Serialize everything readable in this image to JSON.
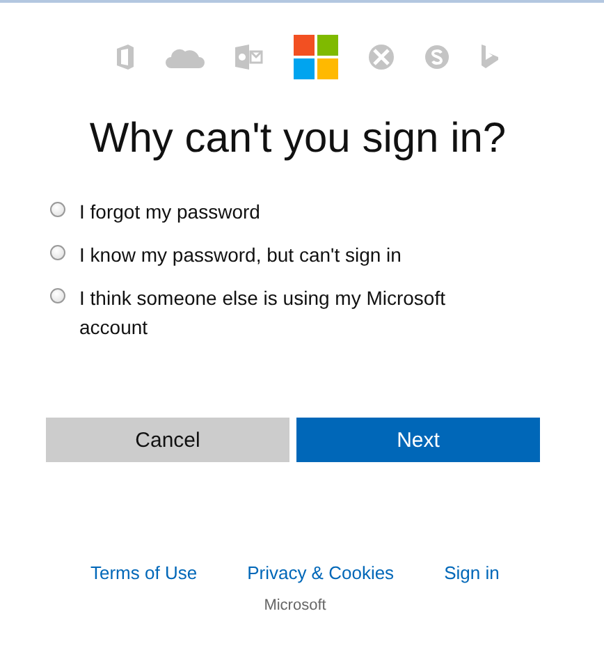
{
  "title": "Why can't you sign in?",
  "options": [
    {
      "label": "I forgot my password",
      "selected": false
    },
    {
      "label": "I know my password, but can't sign in",
      "selected": false
    },
    {
      "label": "I think someone else is using my Microsoft account",
      "selected": false
    }
  ],
  "buttons": [
    {
      "label": "Cancel",
      "kind": "secondary"
    },
    {
      "label": "Next",
      "kind": "primary"
    }
  ],
  "footer": {
    "links": [
      "Terms of Use",
      "Privacy & Cookies",
      "Sign in"
    ],
    "brand": "Microsoft"
  }
}
